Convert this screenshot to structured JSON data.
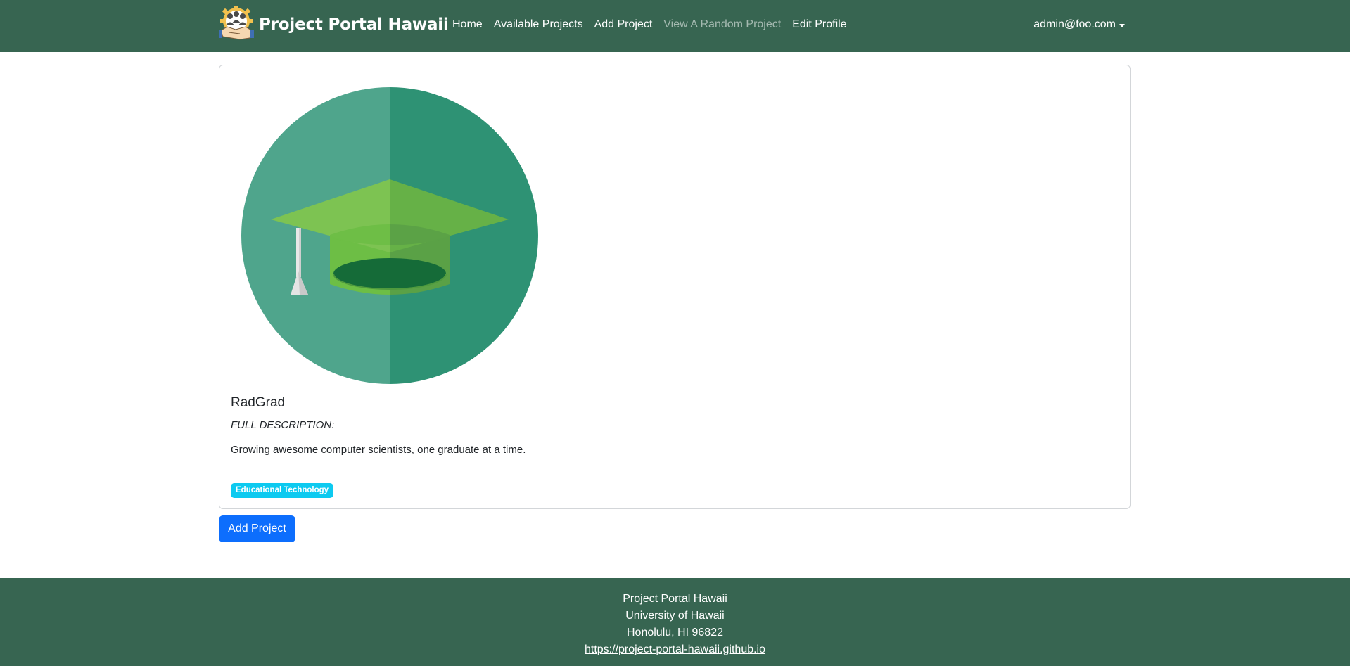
{
  "navbar": {
    "brand": "Project Portal Hawaii",
    "links": [
      {
        "label": "Home"
      },
      {
        "label": "Available Projects"
      },
      {
        "label": "Add Project"
      },
      {
        "label": "View A Random Project"
      },
      {
        "label": "Edit Profile"
      }
    ],
    "user": "admin@foo.com"
  },
  "project": {
    "image_icon": "graduation-cap-icon",
    "name": "RadGrad",
    "description_heading": "FULL DESCRIPTION:",
    "description": "Growing awesome computer scientists, one graduate at a time.",
    "tags": [
      "Educational Technology"
    ]
  },
  "actions": {
    "add_project_label": "Add Project"
  },
  "footer": {
    "lines": [
      "Project Portal Hawaii",
      "University of Hawaii",
      "Honolulu, HI 96822"
    ],
    "link": "https://project-portal-hawaii.github.io"
  },
  "colors": {
    "navbar_bg": "#376551",
    "primary": "#0d6efd",
    "badge": "#0dcaf0",
    "circle_light": "#4fa58c",
    "circle_dark": "#2e9274"
  }
}
